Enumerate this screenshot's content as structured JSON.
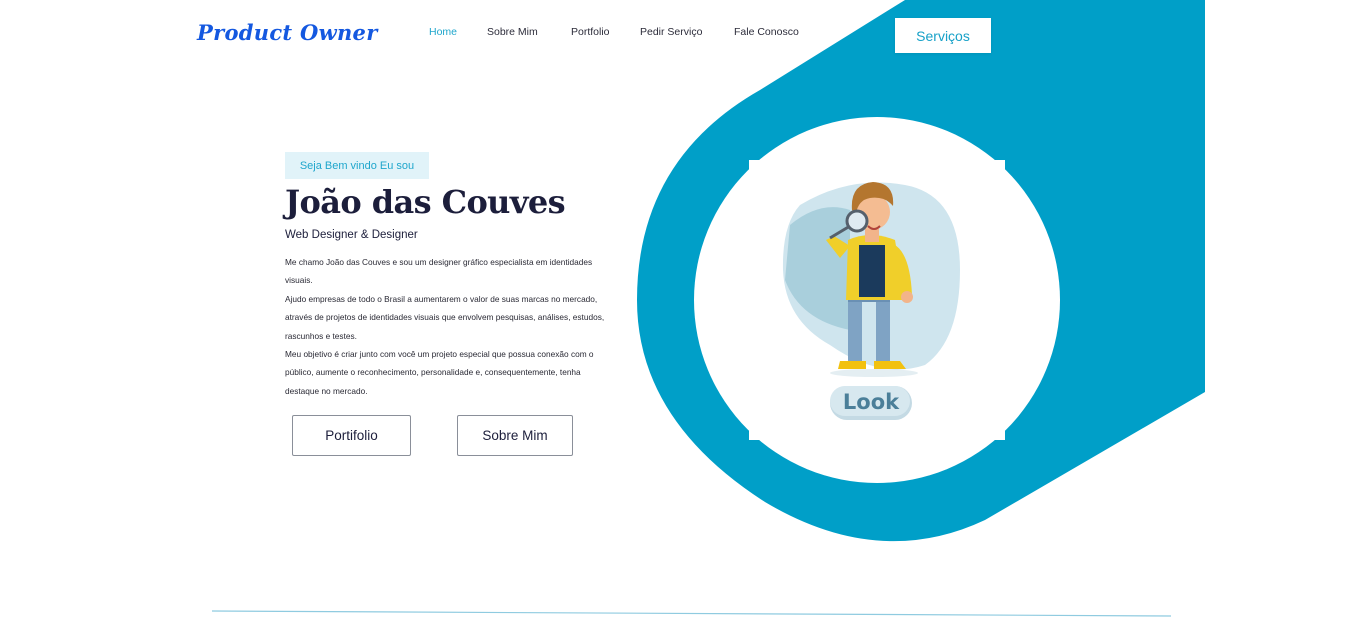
{
  "brand": {
    "logo": "Product Owner"
  },
  "nav": {
    "items": [
      {
        "label": "Home",
        "active": true
      },
      {
        "label": "Sobre Mim",
        "active": false
      },
      {
        "label": "Portfolio",
        "active": false
      },
      {
        "label": "Pedir Serviço",
        "active": false
      },
      {
        "label": "Fale Conosco",
        "active": false
      }
    ],
    "cta_label": "Serviços"
  },
  "hero": {
    "badge": "Seja Bem vindo Eu sou",
    "name": "João das Couves",
    "role": "Web Designer & Designer",
    "bio": [
      "Me chamo João das Couves e sou um designer gráfico especialista em identidades visuais.",
      "Ajudo empresas de todo o Brasil a aumentarem o valor de suas marcas no mercado, através de projetos de identidades visuais que envolvem pesquisas, análises, estudos, rascunhos e testes.",
      "Meu objetivo é criar junto com você um projeto especial que possua conexão com o público, aumente o reconhecimento, personalidade e, consequentemente, tenha destaque no mercado."
    ],
    "buttons": {
      "portfolio": "Portifolio",
      "about": "Sobre Mim"
    }
  },
  "illustration": {
    "tag": "Look"
  },
  "colors": {
    "accent": "#009fc8",
    "brand": "#1458e0",
    "heading": "#1c1e3b"
  }
}
